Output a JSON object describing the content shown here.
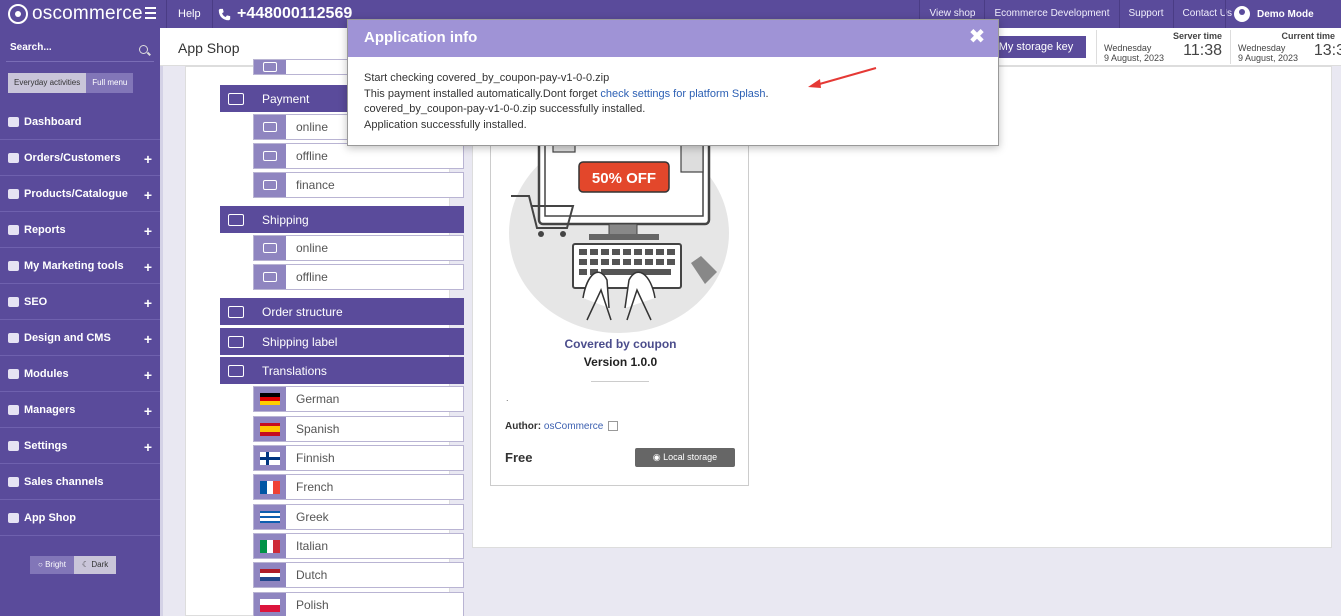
{
  "topbar": {
    "logo_text": "oscommerce",
    "help": "Help",
    "phone": "+448000112569",
    "links": [
      "View shop",
      "Ecommerce Development",
      "Support",
      "Contact Us"
    ],
    "user": "Demo Mode"
  },
  "sidebar": {
    "search_label": "Search...",
    "modes": [
      "Everyday activities",
      "Full menu"
    ],
    "items": [
      {
        "label": "Dashboard",
        "expandable": false
      },
      {
        "label": "Orders/Customers",
        "expandable": true
      },
      {
        "label": "Products/Catalogue",
        "expandable": true
      },
      {
        "label": "Reports",
        "expandable": true
      },
      {
        "label": "My Marketing tools",
        "expandable": true
      },
      {
        "label": "SEO",
        "expandable": true
      },
      {
        "label": "Design and CMS",
        "expandable": true
      },
      {
        "label": "Modules",
        "expandable": true
      },
      {
        "label": "Managers",
        "expandable": true
      },
      {
        "label": "Settings",
        "expandable": true
      },
      {
        "label": "Sales channels",
        "expandable": false
      },
      {
        "label": "App Shop",
        "expandable": false
      }
    ],
    "theme": [
      "Bright",
      "Dark"
    ],
    "plus_glyph": "+"
  },
  "header": {
    "title": "App Shop",
    "storage_button": "My storage key",
    "server_time": {
      "label": "Server time",
      "day": "Wednesday",
      "date": "9 August, 2023",
      "time": "11:38"
    },
    "current_time": {
      "label": "Current time",
      "day": "Wednesday",
      "date": "9 August, 2023",
      "time": "13:3"
    }
  },
  "tree": {
    "payment": "Payment",
    "payment_items": [
      "online",
      "offline",
      "finance"
    ],
    "shipping": "Shipping",
    "shipping_items": [
      "online",
      "offline"
    ],
    "order_structure": "Order structure",
    "shipping_label": "Shipping label",
    "translations": "Translations",
    "languages": [
      "German",
      "Spanish",
      "Finnish",
      "French",
      "Greek",
      "Italian",
      "Dutch",
      "Polish"
    ]
  },
  "card": {
    "badge": "50% OFF",
    "title": "Covered by coupon",
    "version": "Version 1.0.0",
    "dot": ".",
    "author_label": "Author:",
    "author": "osCommerce",
    "price": "Free",
    "local_button": "Local storage"
  },
  "modal": {
    "title": "Application info",
    "close_glyph": "✖",
    "line1": "Start checking covered_by_coupon-pay-v1-0-0.zip",
    "line2_prefix": "This payment installed automatically.Dont forget ",
    "line2_link": "check settings for platform Splash",
    "line2_suffix": ".",
    "line3": "covered_by_coupon-pay-v1-0-0.zip successfully installed.",
    "line4": "Application successfully installed."
  },
  "colors": {
    "brand": "#5a4b9b",
    "modal_header": "#9f93d6",
    "link": "#2b5fb4",
    "arrow": "#e53935"
  }
}
